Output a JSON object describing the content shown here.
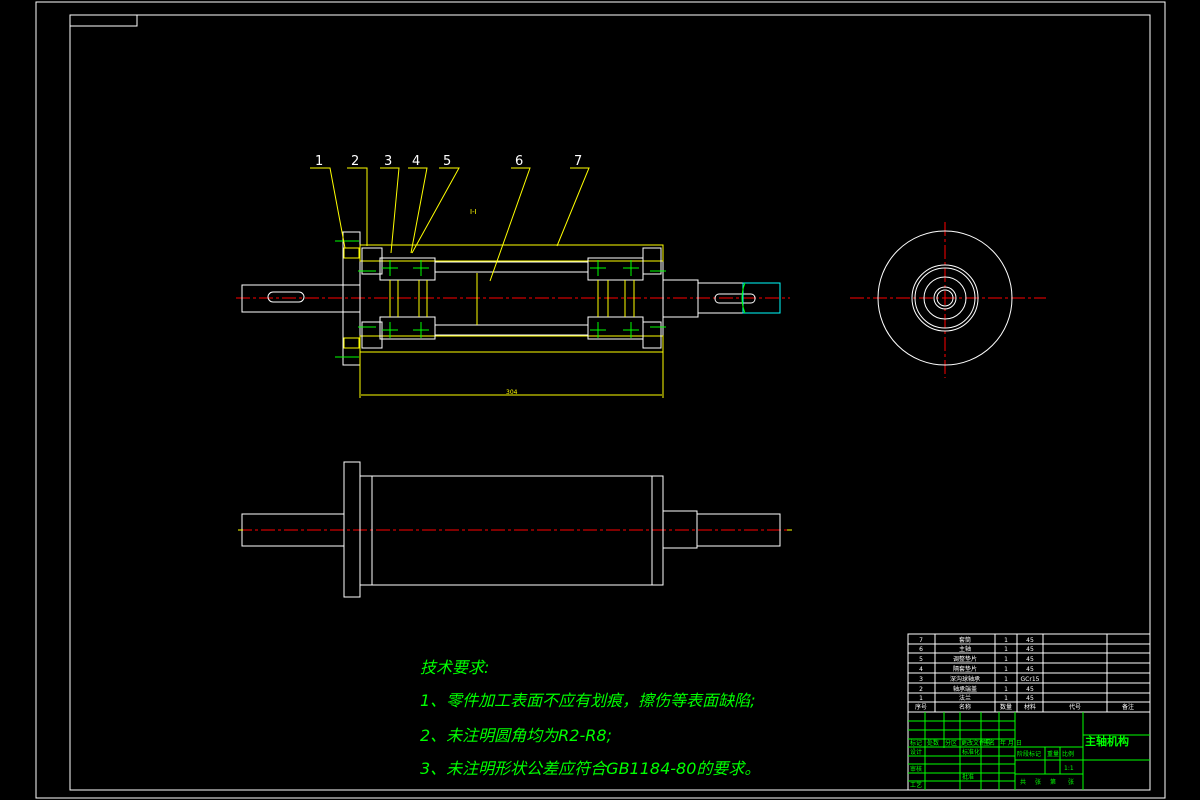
{
  "part_numbers": [
    "1",
    "2",
    "3",
    "4",
    "5",
    "6",
    "7"
  ],
  "section_label": "I-I",
  "dimension_length": "304",
  "tech_requirements": {
    "title": "技术要求:",
    "items": [
      "1、零件加工表面不应有划痕，擦伤等表面缺陷;",
      "2、未注明圆角均为R2-R8;",
      "3、未注明形状公差应符合GB1184-80的要求。"
    ]
  },
  "parts_list": {
    "headers": [
      "序号",
      "名称",
      "数量",
      "材料",
      "代号",
      "备注"
    ],
    "rows": [
      {
        "no": "7",
        "name": "套筒",
        "qty": "1",
        "material": "45"
      },
      {
        "no": "6",
        "name": "主轴",
        "qty": "1",
        "material": "45"
      },
      {
        "no": "5",
        "name": "调整垫片",
        "qty": "1",
        "material": "45"
      },
      {
        "no": "4",
        "name": "隔套垫片",
        "qty": "1",
        "material": "45"
      },
      {
        "no": "3",
        "name": "深沟球轴承",
        "qty": "1",
        "material": "GCr15"
      },
      {
        "no": "2",
        "name": "轴承端盖",
        "qty": "1",
        "material": "45"
      },
      {
        "no": "1",
        "name": "法兰",
        "qty": "1",
        "material": "45"
      }
    ]
  },
  "title_block": {
    "drawing_title": "主轴机构",
    "labels": [
      "标记",
      "处数",
      "分区",
      "更改文件号",
      "签名",
      "年 月 日",
      "设计",
      "标准化",
      "审核",
      "工艺",
      "批准",
      "阶段标记",
      "重量",
      "比例",
      "共",
      "张",
      "第",
      "张"
    ],
    "scale": "1:1"
  },
  "colors": {
    "background": "#000000",
    "outline": "#ffffff",
    "leader": "#ffff00",
    "text": "#00ff00",
    "centerline": "#ff0000"
  }
}
